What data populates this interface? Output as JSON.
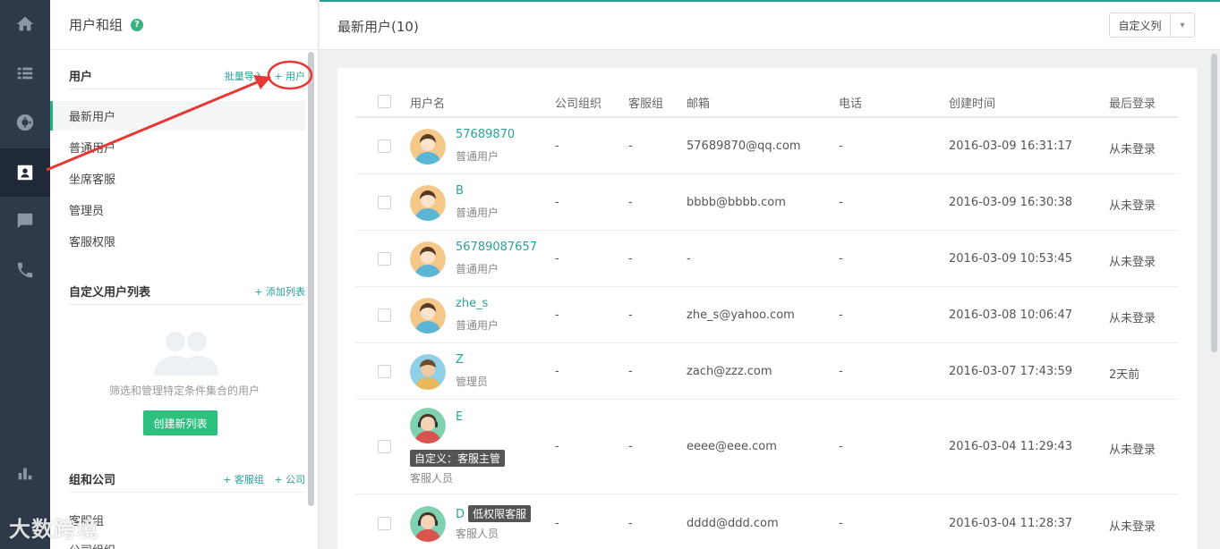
{
  "nav": {
    "items": [
      {
        "icon": "home-icon"
      },
      {
        "icon": "list-icon"
      },
      {
        "icon": "support-icon"
      },
      {
        "icon": "contacts-icon",
        "active": true
      },
      {
        "icon": "chat-icon"
      },
      {
        "icon": "phone-icon"
      },
      {
        "icon": "stats-icon"
      }
    ]
  },
  "sidebar": {
    "title": "用户和组",
    "help": "?",
    "users_section": {
      "title": "用户",
      "link_bulk": "批量导入",
      "link_add": "+ 用户"
    },
    "items": [
      {
        "label": "最新用户",
        "active": true
      },
      {
        "label": "普通用户"
      },
      {
        "label": "坐席客服"
      },
      {
        "label": "管理员"
      },
      {
        "label": "客服权限"
      }
    ],
    "custom_section": {
      "title": "自定义用户列表",
      "link_add": "+ 添加列表",
      "empty_text": "筛选和管理特定条件集合的用户",
      "create_button": "创建新列表"
    },
    "groups_section": {
      "title": "组和公司",
      "link_group": "+ 客服组",
      "link_company": "+ 公司",
      "items": [
        {
          "label": "客服组"
        },
        {
          "label": "公司组织"
        }
      ]
    }
  },
  "main": {
    "title": "最新用户(10)",
    "custom_columns_label": "自定义列",
    "columns": [
      "用户名",
      "公司组织",
      "客服组",
      "邮箱",
      "电话",
      "创建时间",
      "最后登录"
    ],
    "rows": [
      {
        "name": "57689870",
        "role": "普通用户",
        "company": "-",
        "group": "-",
        "email": "57689870@qq.com",
        "phone": "-",
        "created": "2016-03-09 16:31:17",
        "last_login": "从未登录",
        "avatar": "user"
      },
      {
        "name": "B",
        "role": "普通用户",
        "company": "-",
        "group": "-",
        "email": "bbbb@bbbb.com",
        "phone": "-",
        "created": "2016-03-09 16:30:38",
        "last_login": "从未登录",
        "avatar": "user"
      },
      {
        "name": "56789087657",
        "role": "普通用户",
        "company": "-",
        "group": "-",
        "email": "-",
        "phone": "-",
        "created": "2016-03-09 10:53:45",
        "last_login": "从未登录",
        "avatar": "user"
      },
      {
        "name": "zhe_s",
        "role": "普通用户",
        "company": "-",
        "group": "-",
        "email": "zhe_s@yahoo.com",
        "phone": "-",
        "created": "2016-03-08 10:06:47",
        "last_login": "从未登录",
        "avatar": "user"
      },
      {
        "name": "Z",
        "role": "管理员",
        "company": "-",
        "group": "-",
        "email": "zach@zzz.com",
        "phone": "-",
        "created": "2016-03-07 17:43:59",
        "last_login": "2天前",
        "avatar": "admin"
      },
      {
        "name": "E",
        "tag": "自定义：客服主管",
        "role": "客服人员",
        "company": "-",
        "group": "-",
        "email": "eeee@eee.com",
        "phone": "-",
        "created": "2016-03-04 11:29:43",
        "last_login": "从未登录",
        "avatar": "agent"
      },
      {
        "name": "D",
        "tag": "低权限客服",
        "role": "客服人员",
        "company": "-",
        "group": "-",
        "email": "dddd@ddd.com",
        "phone": "-",
        "created": "2016-03-04 11:28:37",
        "last_login": "从未登录",
        "avatar": "agent"
      }
    ]
  },
  "watermark": "大数跨境",
  "colors": {
    "accent": "#2aa198",
    "green": "#2dc07f",
    "nav_bg": "#2e3a4a",
    "annotation": "#e53935"
  }
}
